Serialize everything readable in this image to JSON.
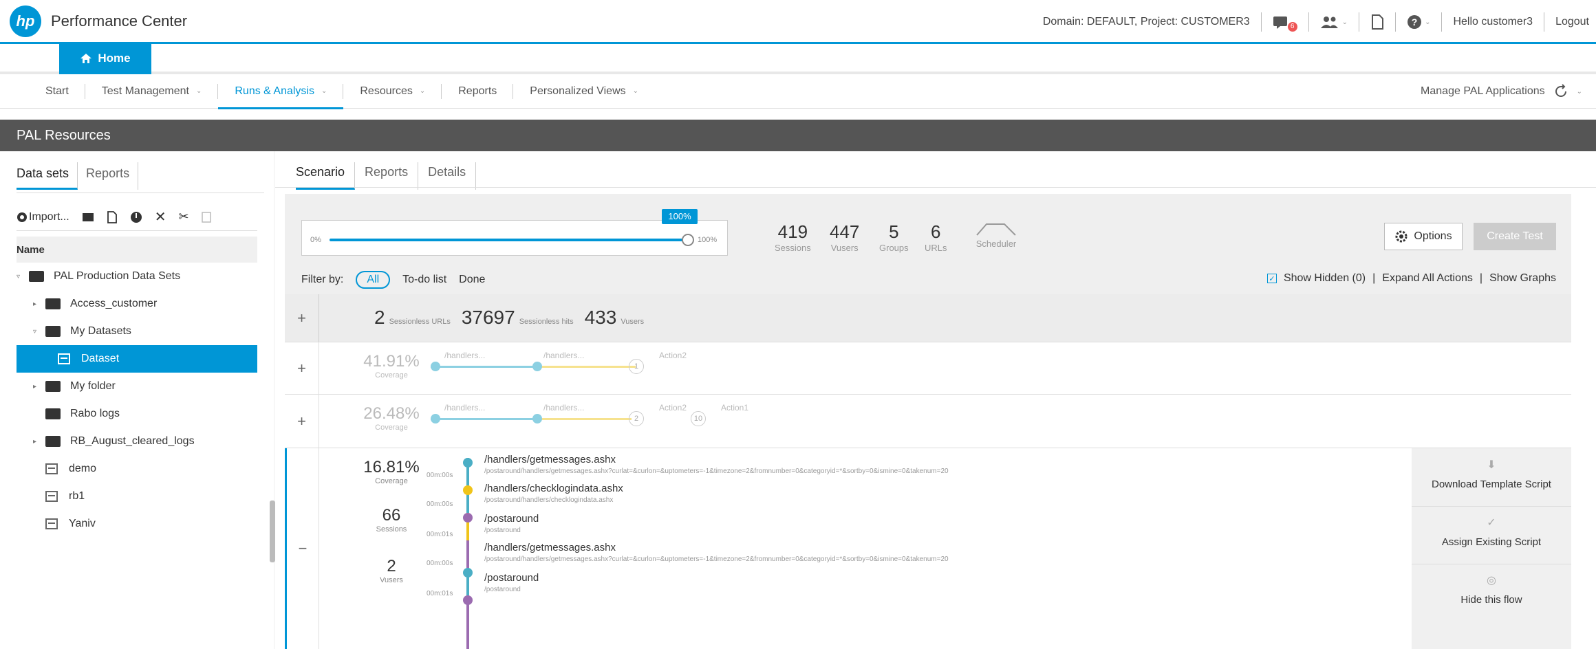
{
  "header": {
    "logo": "hp",
    "app_title": "Performance Center",
    "domain_project": "Domain: DEFAULT, Project: CUSTOMER3",
    "notification_count": "6",
    "hello": "Hello customer3",
    "logout": "Logout"
  },
  "home_tab": {
    "label": "Home"
  },
  "nav": {
    "items": [
      {
        "label": "Start",
        "caret": ""
      },
      {
        "label": "Test Management",
        "caret": "⌄"
      },
      {
        "label": "Runs & Analysis",
        "caret": "⌄"
      },
      {
        "label": "Resources",
        "caret": "⌄"
      },
      {
        "label": "Reports",
        "caret": ""
      },
      {
        "label": "Personalized Views",
        "caret": "⌄"
      }
    ],
    "manage_pal": "Manage PAL Applications"
  },
  "banner": {
    "title": "PAL Resources"
  },
  "left": {
    "tabs": [
      "Data sets",
      "Reports"
    ],
    "import_label": "Import...",
    "name_header": "Name",
    "tree": [
      {
        "label": "PAL Production Data Sets",
        "type": "folder",
        "arrow": "▿"
      },
      {
        "label": "Access_customer",
        "type": "folder",
        "arrow": "▸"
      },
      {
        "label": "My Datasets",
        "type": "folder",
        "arrow": "▿"
      },
      {
        "label": "Dataset",
        "type": "dataset",
        "arrow": ""
      },
      {
        "label": "My folder",
        "type": "folder",
        "arrow": "▸"
      },
      {
        "label": "Rabo logs",
        "type": "folder",
        "arrow": ""
      },
      {
        "label": "RB_August_cleared_logs",
        "type": "folder",
        "arrow": "▸"
      },
      {
        "label": "demo",
        "type": "dataset",
        "arrow": ""
      },
      {
        "label": "rb1",
        "type": "dataset",
        "arrow": ""
      },
      {
        "label": "Yaniv",
        "type": "dataset",
        "arrow": ""
      }
    ]
  },
  "main": {
    "tabs": [
      "Scenario",
      "Reports",
      "Details"
    ],
    "slider": {
      "min_label": "0%",
      "max_label": "100%",
      "tooltip": "100%",
      "value_pct": 100
    },
    "stats": [
      {
        "value": "419",
        "label": "Sessions"
      },
      {
        "value": "447",
        "label": "Vusers"
      },
      {
        "value": "5",
        "label": "Groups"
      },
      {
        "value": "6",
        "label": "URLs"
      }
    ],
    "scheduler_label": "Scheduler",
    "options_label": "Options",
    "create_test_label": "Create Test",
    "filter": {
      "label": "Filter by:",
      "all": "All",
      "todo": "To-do list",
      "done": "Done"
    },
    "links": {
      "show_hidden": "Show Hidden (0)",
      "expand_all": "Expand All Actions",
      "show_graphs": "Show Graphs"
    },
    "sessionless": [
      {
        "n": "2",
        "l": "Sessionless URLs"
      },
      {
        "n": "37697",
        "l": "Sessionless hits"
      },
      {
        "n": "433",
        "l": "Vusers"
      }
    ],
    "flow1": {
      "coverage": "41.91%",
      "coverage_label": "Coverage",
      "labels": [
        "/handlers...",
        "/handlers...",
        "Action2"
      ],
      "circle": "1"
    },
    "flow2": {
      "coverage": "26.48%",
      "coverage_label": "Coverage",
      "labels": [
        "/handlers...",
        "/handlers...",
        "Action2",
        "Action1"
      ],
      "circles": [
        "2",
        "10"
      ]
    },
    "flow3": {
      "coverage": "16.81%",
      "coverage_label": "Coverage",
      "sessions": "66",
      "sessions_label": "Sessions",
      "vusers": "2",
      "vusers_label": "Vusers",
      "steps": [
        {
          "title": "/handlers/getmessages.ashx",
          "sub": "/postaround/handlers/getmessages.ashx?curlat=&curlon=&uptometers=-1&timezone=2&fromnumber=0&categoryid=*&sortby=0&ismine=0&takenum=20",
          "dur": "00m:00s",
          "color": "#4aaec5"
        },
        {
          "title": "/handlers/checklogindata.ashx",
          "sub": "/postaround/handlers/checklogindata.ashx",
          "dur": "00m:00s",
          "color": "#f0c419"
        },
        {
          "title": "/postaround",
          "sub": "/postaround",
          "dur": "00m:01s",
          "color": "#9b6bb0"
        },
        {
          "title": "/handlers/getmessages.ashx",
          "sub": "/postaround/handlers/getmessages.ashx?curlat=&curlon=&uptometers=-1&timezone=2&fromnumber=0&categoryid=*&sortby=0&ismine=0&takenum=20",
          "dur": "00m:00s",
          "color": "#4aaec5"
        },
        {
          "title": "/postaround",
          "sub": "/postaround",
          "dur": "00m:01s",
          "color": "#9b6bb0"
        }
      ],
      "actions": [
        "Download Template Script",
        "Assign Existing Script",
        "Hide this flow"
      ]
    }
  },
  "colors": {
    "accent": "#0096d6",
    "banner": "#555555"
  }
}
